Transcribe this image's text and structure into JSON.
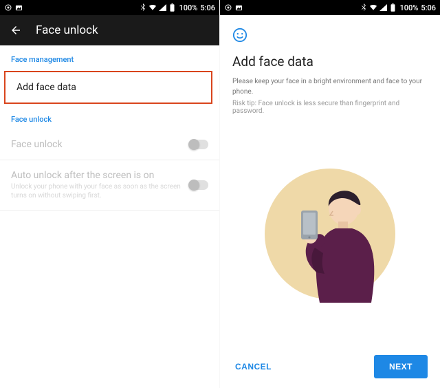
{
  "status": {
    "battery": "100%",
    "time": "5:06"
  },
  "left": {
    "titlebar": "Face unlock",
    "section1": "Face management",
    "add_face": "Add face data",
    "section2": "Face unlock",
    "face_unlock_row": "Face unlock",
    "auto_unlock_title": "Auto unlock after the screen is on",
    "auto_unlock_sub": "Unlock your phone with your face as soon as the screen turns on without swiping first."
  },
  "right": {
    "title": "Add face data",
    "sub": "Please keep your face in a bright environment and face to your phone.",
    "risk": "Risk tip: Face unlock is less secure than fingerprint and password.",
    "cancel": "CANCEL",
    "next": "NEXT"
  }
}
